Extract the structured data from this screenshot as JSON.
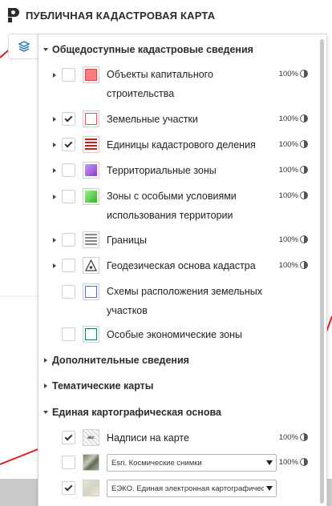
{
  "header": {
    "title": "ПУБЛИЧНАЯ КАДАСТРОВАЯ КАРТА"
  },
  "sections": {
    "public": "Общедоступные кадастровые сведения",
    "additional": "Дополнительные сведения",
    "thematic": "Тематические карты",
    "basemap": "Единая картографическая основа"
  },
  "layers": [
    {
      "label": "Объекты капитального строительства",
      "pct": "100%",
      "checked": false,
      "swatch": "oks-red"
    },
    {
      "label": "Земельные участки",
      "pct": "100%",
      "checked": true,
      "swatch": "parcel-outline"
    },
    {
      "label": "Единицы кадастрового деления",
      "pct": "100%",
      "checked": true,
      "swatch": "kad-division"
    },
    {
      "label": "Территориальные зоны",
      "pct": "100%",
      "checked": false,
      "swatch": "purple"
    },
    {
      "label": "Зоны с особыми условиями использования территории",
      "pct": "100%",
      "checked": false,
      "swatch": "green"
    },
    {
      "label": "Границы",
      "pct": "100%",
      "checked": false,
      "swatch": "borders"
    },
    {
      "label": "Геодезическая основа кадастра",
      "pct": "100%",
      "checked": false,
      "swatch": "geodesy-triangle"
    },
    {
      "label": "Схемы расположения земельных участков",
      "checked": false,
      "swatch": "blue-outline"
    },
    {
      "label": "Особые экономические зоны",
      "checked": false,
      "swatch": "teal-outline"
    }
  ],
  "basemap_layers": [
    {
      "label": "Надписи на карте",
      "pct": "100%",
      "checked": true
    },
    {
      "select_value": "Esri. Космические снимки",
      "pct": "100%",
      "checked": false
    },
    {
      "select_value": "ЕЭКО. Единая электронная картографическая основа",
      "checked": true
    }
  ],
  "colors": {
    "accent": "#1e6fb8",
    "red_line": "#e02020"
  }
}
